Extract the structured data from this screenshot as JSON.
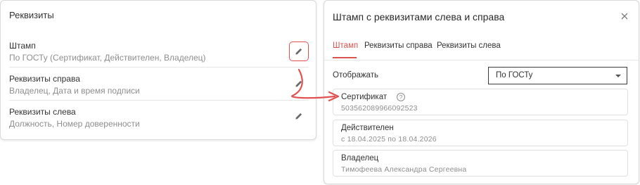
{
  "left_panel": {
    "title": "Реквизиты",
    "rows": [
      {
        "name": "Штамп",
        "subtitle": "По ГОСТу (Сертификат, Действителен, Владелец)"
      },
      {
        "name": "Реквизиты справа",
        "subtitle": "Владелец, Дата и время подписи"
      },
      {
        "name": "Реквизиты слева",
        "subtitle": "Должность, Номер доверенности"
      }
    ]
  },
  "dialog": {
    "title": "Штамп с реквизитами слева и справа",
    "tabs": [
      {
        "label": "Штамп",
        "active": true
      },
      {
        "label": "Реквизиты справа",
        "active": false
      },
      {
        "label": "Реквизиты слева",
        "active": false
      }
    ],
    "display_label": "Отображать",
    "display_select_value": "По ГОСТу",
    "fields": [
      {
        "label": "Сертификат",
        "value": "503562089966092523",
        "help_icon": "?"
      },
      {
        "label": "Действителен",
        "value": "с 18.04.2025 по 18.04.2026"
      },
      {
        "label": "Владелец",
        "value": "Тимофеева Александра Сергеевна"
      }
    ]
  },
  "colors": {
    "accent": "#d9534f",
    "highlight_border": "#e05252",
    "annotation_arrow": "#e05252",
    "muted_text": "#8e8e8e"
  },
  "icons": {
    "edit": "pencil-icon",
    "close": "close-icon",
    "help": "question-circle-icon",
    "dropdown": "chevron-down-icon"
  }
}
